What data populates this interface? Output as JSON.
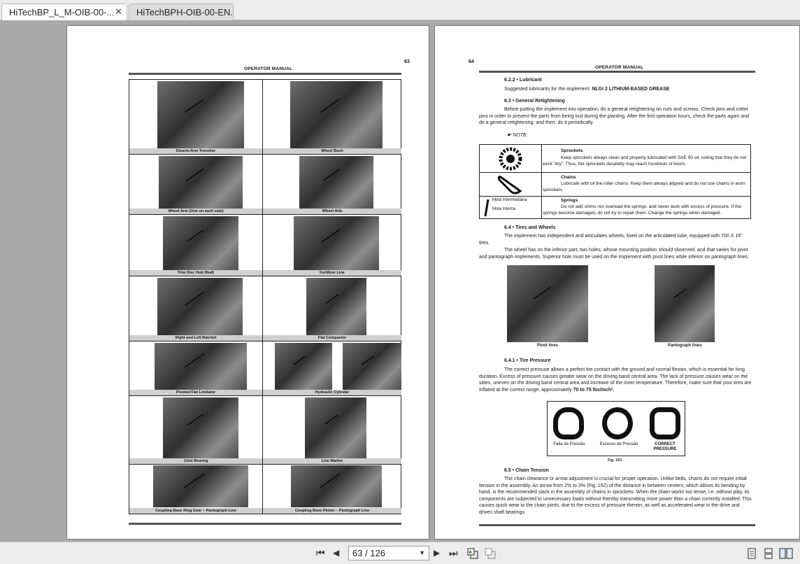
{
  "tabs": [
    {
      "label": "HiTechBP_L_M-OIB-00-...",
      "close": "✕"
    },
    {
      "label": "HiTechBPH-OIB-00-EN..."
    }
  ],
  "left_page": {
    "header": "OPERATOR MANUAL",
    "page_number": "63",
    "captions": [
      "Disarm-Arm Trencher",
      "Wheel Bush",
      "Wheel Arm (One on each side)",
      "Wheel Hub",
      "Trim Disc Hub Shaft",
      "Fertilizer Line",
      "Right and Left Ratchet",
      "Flat Compactor",
      "Pivoted Flat Limitator",
      "Hydraulic Cylinder",
      "Joint Bearing",
      "Line Marker",
      "Coupling Base Ring Gear – Pantograph Line",
      "Coupling Base Pinion – Pantograph Line"
    ]
  },
  "right_page": {
    "header": "OPERATOR MANUAL",
    "page_number": "64",
    "s622_title": "6.2.2 • Lubricant",
    "s622_text": "Suggested lubricants for the implement:",
    "s622_bold": "NLGI 2 LITHIUM-BASED GREASE",
    "s63_title": "6.3 • General Retightening",
    "s63_text": "Before putting the implement into operation, do a general retightening on nuts and screws. Check pins and cotter pins in order to prevent the parts from being lost during the planting. After the first operation hours, check the parts again and do a general retightening, and then. do it periodically.",
    "note": "NOTE:",
    "notes": [
      {
        "title": "Sprockets",
        "text": "Keep sprockets always clean and properly lubricated with SAE 90 oil, noting that they do not work \"dry\". Thus, the sprockets durability may reach hundreds of hours."
      },
      {
        "title": "Chains",
        "text": "Lubricate with oil the roller chains. Keep them always aligned and do not use chains in worn sprockets."
      },
      {
        "title": "Springs",
        "text": "Do not add shims nor overload the springs, and never work with excess of pressure. If the springs become damaged, do not try to repair them. Change the springs when damaged."
      }
    ],
    "spring_labels": [
      "Mola Intermediária",
      "Mola Interna"
    ],
    "s64_title": "6.4 • Tires and Wheels",
    "s64_text1": "The implement has independent and articulates wheels, fixed on the articulated tube, equipped with 700 X 16\" tires.",
    "s64_text2": "The wheel has on the inferior part, two holes, whose mounting position should observed, and that varies for pivot and pantograph implements. Superior hole must be used on the implement with pivot lines while inferior on pantograph lines.",
    "photo_captions": [
      "Pivot lines",
      "Pantograph lines"
    ],
    "s641_title": "6.4.1 • Tire Pressure",
    "s641_text": "The correct pressure allows a perfect tire contact with the ground and normal flexion, which is essential for long duration. Excess of pressure causes greater wear on the driving band central area. The lack of pressure causes wear on the sides, uneven on the driving band central area and increase of the inner temperature. Therefore, make sure that your tires are inflated at the correct range, approximately",
    "s641_bold": "70 to 75 lbs/inch².",
    "tire_labels": [
      "Falta de Pressão",
      "Excesso de Pressão",
      "CORRECT PRESSURE"
    ],
    "fig_label": "Fig. 151",
    "s65_title": "6.5 • Chain Tension",
    "s65_text": "The chain clearance or arrow adjustment is crucial for proper operation. Unlike belts, chains do not require initial tension in the assembly. An arrow from 2% to 3% (Fig. 152) of the distance in between centers, which allows its bending by hand, is the recommended slack in the assembly of chains in sprockets. When the chain works too tense, i.e. without play, its components are subjected to unnecessary loads without thereby transmitting more power than a chain correctly installed. This causes quick wear to the chain joints, due to the excess of pressure therein, as well as accelerated wear in the drive and driven shaft bearings."
  },
  "toolbar": {
    "first": "⏮",
    "prev": "◀",
    "page_indicator": "63 / 126",
    "next": "▶",
    "last": "⏭"
  }
}
